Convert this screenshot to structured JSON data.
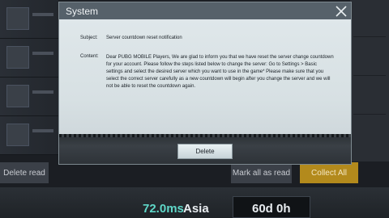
{
  "dialog": {
    "title": "System",
    "subject_label": "Subject:",
    "subject": "Server countdown reset notification",
    "content_label": "Content:",
    "content": "Dear PUBG MOBILE Players, We are glad to inform you that we have reset the server change countdown for your account. Please follow the steps listed below to change the server: Go to Settings > Basic settings and select the desired server which you want to use in the game* Please make sure that you select the correct server carefully as a new countdown will begin after you change the server and we will not be able to reset the countdown again.",
    "delete_label": "Delete",
    "close_icon": "close-icon"
  },
  "mail_bottom": {
    "delete_read_label": "Delete read",
    "mark_all_read_label": "Mark all as read",
    "collect_all_label": "Collect All"
  },
  "status": {
    "ping": "72.0ms",
    "region": "Asia",
    "countdown": "60d 0h"
  },
  "colors": {
    "accent_ping": "#5fd7c8",
    "collect_button": "#b38a1c"
  }
}
